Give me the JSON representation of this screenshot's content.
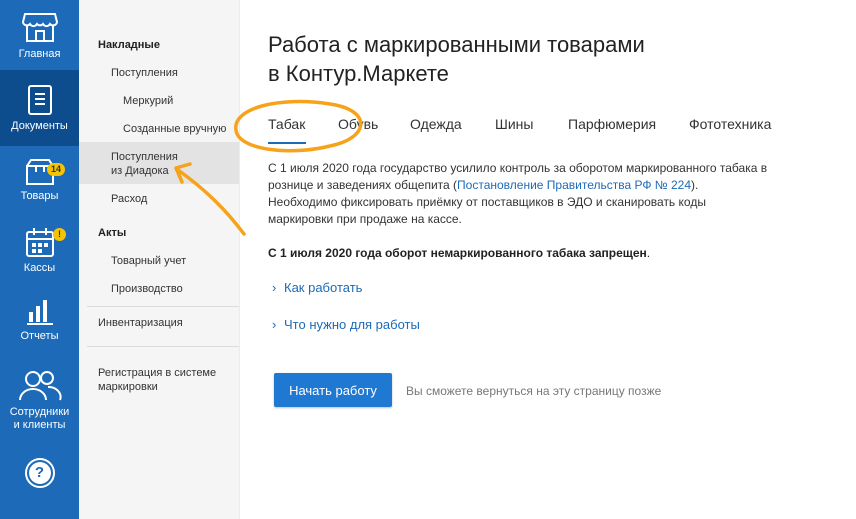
{
  "rail": {
    "home": "Главная",
    "documents": "Документы",
    "goods": "Товары",
    "goods_badge": "14",
    "cash": "Кассы",
    "cash_badge": "!",
    "reports": "Отчеты",
    "staff_line1": "Сотрудники",
    "staff_line2": "и клиенты",
    "help": "?"
  },
  "subnav": {
    "invoices": "Накладные",
    "receipts": "Поступления",
    "mercury": "Меркурий",
    "manual": "Созданные вручную",
    "diadoc_line1": "Поступления",
    "diadoc_line2": "из Диадока",
    "expense": "Расход",
    "acts": "Акты",
    "accounting": "Товарный учет",
    "production": "Производство",
    "inventory": "Инвентаризация",
    "registration_line1": "Регистрация в системе",
    "registration_line2": "маркировки"
  },
  "main": {
    "title_line1": "Работа с маркированными товарами",
    "title_line2": "в Контур.Маркете",
    "tabs": [
      "Табак",
      "Обувь",
      "Одежда",
      "Шины",
      "Парфюмерия",
      "Фототехника"
    ],
    "para_part1": "С 1 июля 2020 года государство усилило контроль за оборотом маркированного табака в рознице и заведениях общепита (",
    "para_link": "Постановление Правительства РФ № 224",
    "para_part2": "). Необходимо фиксировать приёмку от поставщиков в ЭДО и сканировать коды маркировки при продаже на кассе.",
    "strong_text": "С 1 июля 2020 года оборот немаркированного табака запрещен",
    "strong_dot": ".",
    "accordion_how": "Как работать",
    "accordion_need": "Что нужно для работы",
    "start_button": "Начать работу",
    "hint": "Вы сможете вернуться на эту страницу позже"
  },
  "colors": {
    "rail": "#1d6ab8",
    "rail_active": "#0d4d8e",
    "accent": "#1f78d1",
    "annotation": "#f7a21b"
  }
}
